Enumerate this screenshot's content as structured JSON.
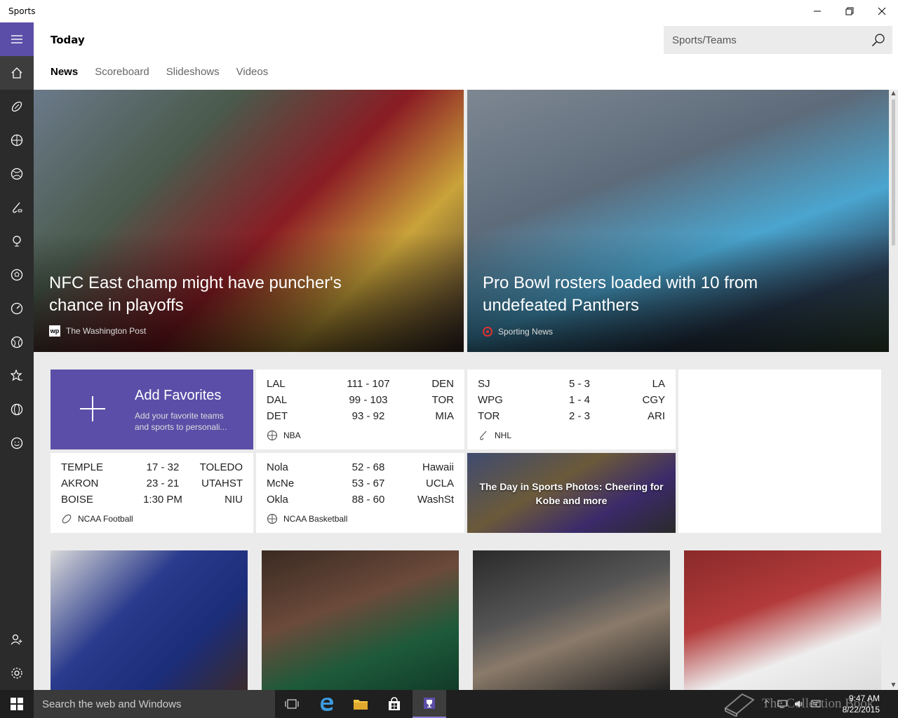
{
  "window": {
    "title": "Sports"
  },
  "header": {
    "page_title": "Today",
    "search_placeholder": "Sports/Teams",
    "tabs": [
      {
        "label": "News",
        "active": true
      },
      {
        "label": "Scoreboard",
        "active": false
      },
      {
        "label": "Slideshows",
        "active": false
      },
      {
        "label": "Videos",
        "active": false
      }
    ]
  },
  "nav": {
    "icons": [
      "hamburger-icon",
      "home-icon",
      "football-icon",
      "basketball-icon",
      "baseball-icon",
      "hockey-icon",
      "golf-icon",
      "soccer-icon",
      "racing-icon",
      "tennis-icon",
      "favorites-icon",
      "world-sports-icon",
      "fantasy-icon"
    ],
    "bottom_icons": [
      "add-person-icon",
      "settings-icon"
    ]
  },
  "hero": [
    {
      "headline": "NFC East champ might have puncher's chance in playoffs",
      "source": "The Washington Post",
      "source_logo": "wp"
    },
    {
      "headline": "Pro Bowl rosters loaded with 10 from undefeated Panthers",
      "source": "Sporting News",
      "source_logo": "sn"
    }
  ],
  "add_favorites": {
    "title": "Add Favorites",
    "subtitle": "Add your favorite teams and sports to personali..."
  },
  "scoreboards": [
    {
      "league": "NBA",
      "games": [
        {
          "home": "LAL",
          "score": "111  -  107",
          "away": "DEN"
        },
        {
          "home": "DAL",
          "score": "99  -  103",
          "away": "TOR"
        },
        {
          "home": "DET",
          "score": "93  -  92",
          "away": "MIA"
        }
      ]
    },
    {
      "league": "NHL",
      "games": [
        {
          "home": "SJ",
          "score": "5  -  3",
          "away": "LA"
        },
        {
          "home": "WPG",
          "score": "1  -  4",
          "away": "CGY"
        },
        {
          "home": "TOR",
          "score": "2  -  3",
          "away": "ARI"
        }
      ]
    },
    {
      "league": "NCAA Football",
      "games": [
        {
          "home": "TEMPLE",
          "score": "17  -  32",
          "away": "TOLEDO"
        },
        {
          "home": "AKRON",
          "score": "23  -  21",
          "away": "UTAHST"
        },
        {
          "home": "BOISE",
          "score": "1:30 PM",
          "away": "NIU"
        }
      ]
    },
    {
      "league": "NCAA Basketball",
      "games": [
        {
          "home": "Nola",
          "score": "52  -  68",
          "away": "Hawaii"
        },
        {
          "home": "McNe",
          "score": "53  -  67",
          "away": "UCLA"
        },
        {
          "home": "Okla",
          "score": "88  -  60",
          "away": "WashSt"
        }
      ]
    }
  ],
  "photo_tile": {
    "caption": "The Day in Sports Photos: Cheering for Kobe and more"
  },
  "taskbar": {
    "search_placeholder": "Search the web and Windows",
    "time": "9:47 AM",
    "date": "8/22/2015",
    "watermark": "The Collection Book"
  },
  "colors": {
    "accent": "#5b4ea8",
    "rail": "#2b2b2b",
    "background": "#ebebeb"
  }
}
